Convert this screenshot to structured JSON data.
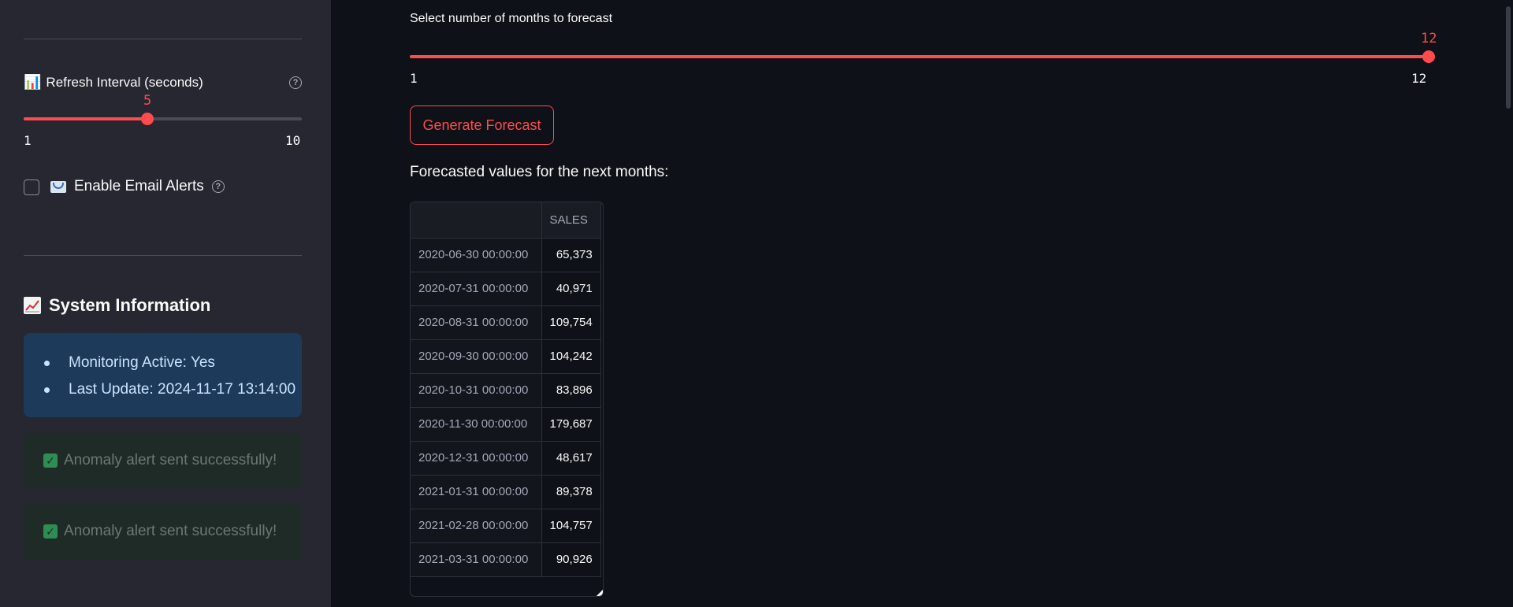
{
  "sidebar": {
    "refresh": {
      "emoji": "📊",
      "label": "Refresh Interval (seconds)",
      "value": "5",
      "min": "1",
      "max": "10",
      "fraction": 0.444
    },
    "email_alerts": {
      "checked": false,
      "emoji": "📧",
      "label": "Enable Email Alerts"
    },
    "system_info": {
      "emoji": "📈",
      "title": "System Information",
      "items": [
        "Monitoring Active: Yes",
        "Last Update: 2024-11-17 13:14:00"
      ]
    },
    "alerts": [
      "Anomaly alert sent successfully!",
      "Anomaly alert sent successfully!"
    ]
  },
  "main": {
    "months_slider": {
      "label": "Select number of months to forecast",
      "value": "12",
      "min": "1",
      "max": "12",
      "fraction": 1.0
    },
    "generate_button": "Generate Forecast",
    "forecast_heading": "Forecasted values for the next months:",
    "table": {
      "columns": [
        "",
        "SALES"
      ],
      "rows": [
        [
          "2020-06-30 00:00:00",
          "65,373"
        ],
        [
          "2020-07-31 00:00:00",
          "40,971"
        ],
        [
          "2020-08-31 00:00:00",
          "109,754"
        ],
        [
          "2020-09-30 00:00:00",
          "104,242"
        ],
        [
          "2020-10-31 00:00:00",
          "83,896"
        ],
        [
          "2020-11-30 00:00:00",
          "179,687"
        ],
        [
          "2020-12-31 00:00:00",
          "48,617"
        ],
        [
          "2021-01-31 00:00:00",
          "89,378"
        ],
        [
          "2021-02-28 00:00:00",
          "104,757"
        ],
        [
          "2021-03-31 00:00:00",
          "90,926"
        ]
      ]
    }
  },
  "colors": {
    "accent": "#ff4b4b",
    "background": "#0e1117",
    "sidebar": "#262730",
    "info_bg": "#1d3a5a",
    "success_bg": "#1f2b27"
  }
}
